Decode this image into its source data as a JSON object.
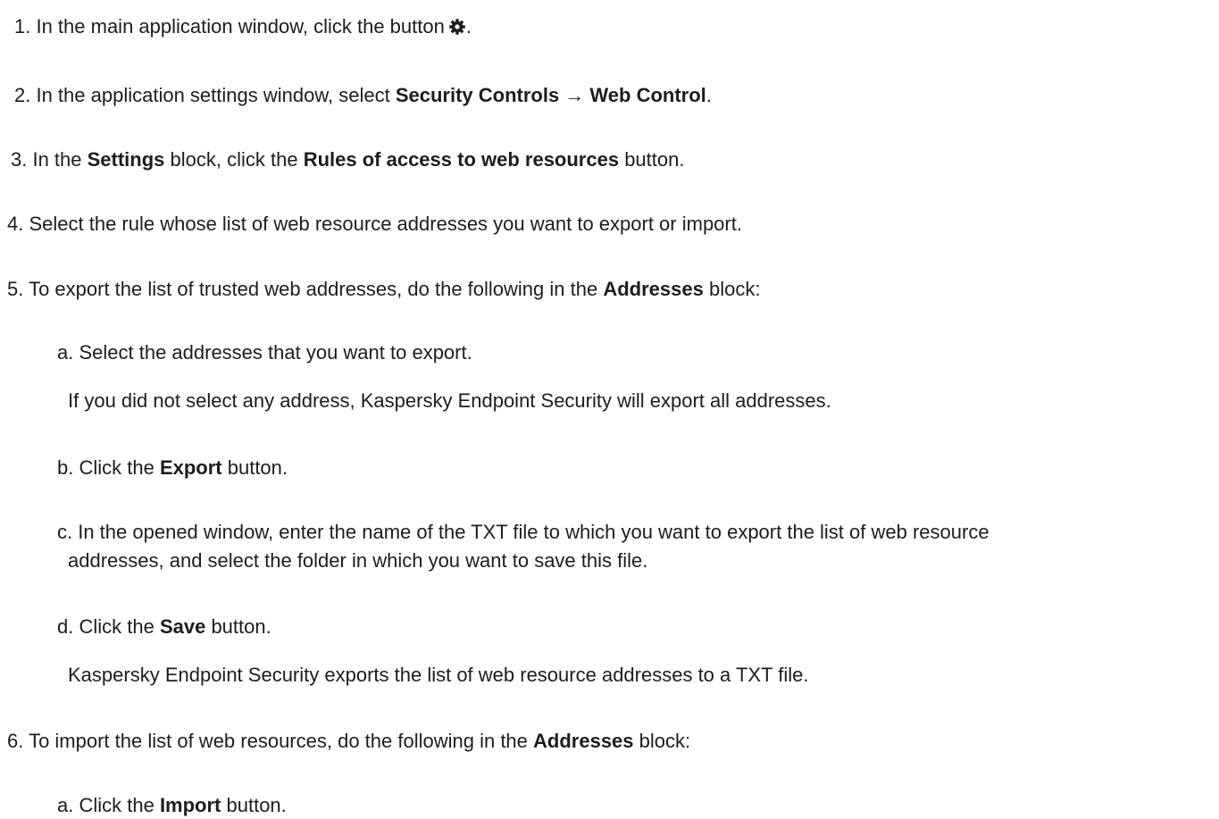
{
  "steps": {
    "s1": {
      "prefix": "1. In the main application window, click the button",
      "icon": "gear-icon",
      "suffix": "."
    },
    "s2": {
      "prefix": "2. In the application settings window, select ",
      "b1": "Security Controls",
      "arrow": " → ",
      "b2": "Web Control",
      "suffix": "."
    },
    "s3": {
      "prefix": "3. In the ",
      "b1": "Settings",
      "mid": " block, click the ",
      "b2": "Rules of access to web resources",
      "suffix": " button."
    },
    "s4": {
      "text": "4. Select the rule whose list of web resource addresses you want to export or import."
    },
    "s5": {
      "prefix": "5. To export the list of trusted web addresses, do the following in the ",
      "b1": "Addresses",
      "suffix": " block:",
      "a": {
        "text": "a. Select the addresses that you want to export.",
        "note": "If you did not select any address, Kaspersky Endpoint Security will export all addresses."
      },
      "b": {
        "prefix": "b. Click the ",
        "bold": "Export",
        "suffix": " button."
      },
      "c": {
        "line1": "c. In the opened window, enter the name of the TXT file to which you want to export the list of web resource",
        "line2": "addresses, and select the folder in which you want to save this file."
      },
      "d": {
        "prefix": "d. Click the ",
        "bold": "Save",
        "suffix": " button.",
        "note": "Kaspersky Endpoint Security exports the list of web resource addresses to a TXT file."
      }
    },
    "s6": {
      "prefix": "6. To import the list of web resources, do the following in the ",
      "b1": "Addresses",
      "suffix": " block:",
      "a": {
        "prefix": "a. Click the ",
        "bold": "Import",
        "suffix": " button."
      }
    }
  }
}
